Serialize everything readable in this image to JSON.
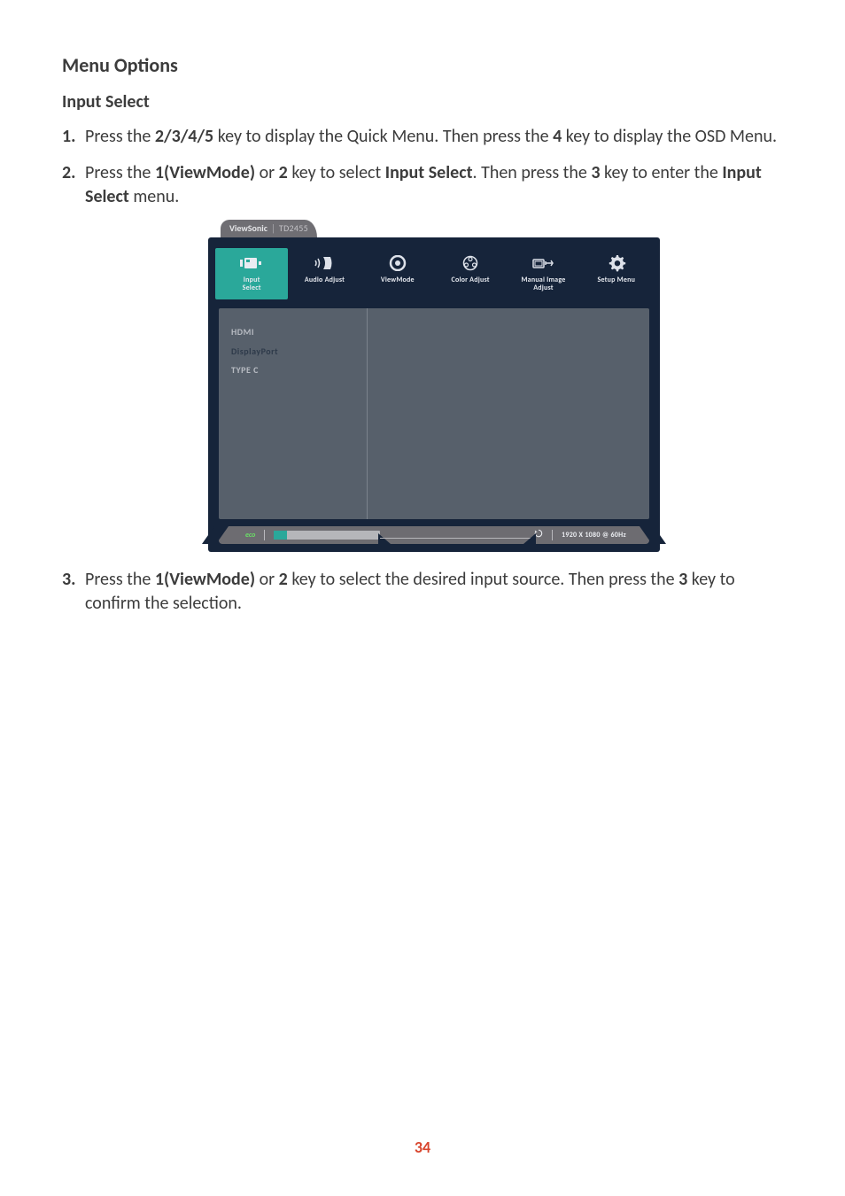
{
  "headings": {
    "menu_options": "Menu Options",
    "input_select": "Input Select"
  },
  "steps": {
    "s1": {
      "pre": "Press the ",
      "keys": "2/3/4/5",
      "mid": " key to display the Quick Menu. Then press the ",
      "key4": "4",
      "post": " key to display the OSD Menu."
    },
    "s2": {
      "pre": "Press the ",
      "k1": "1(ViewMode)",
      "or": " or ",
      "k2": "2",
      "mid": " key to select ",
      "sel": "Input Select",
      "then": ". Then press the ",
      "k3": "3",
      "enter": " key to enter the ",
      "sel2": "Input Select",
      "post": " menu."
    },
    "s3": {
      "pre": "Press the ",
      "k1": "1(ViewMode)",
      "or": " or ",
      "k2": "2",
      "mid": " key to select the desired input source. Then press the ",
      "k3": "3",
      "post": " key to confirm the selection."
    }
  },
  "osd": {
    "brand": "ViewSonic",
    "model": "TD2455",
    "tabs": {
      "input_select": "Input\nSelect",
      "audio_adjust": "Audio Adjust",
      "view_mode": "ViewMode",
      "color_adjust": "Color Adjust",
      "manual_image": "Manual Image\nAdjust",
      "setup_menu": "Setup Menu"
    },
    "input_options": {
      "hdmi": "HDMI",
      "displayport": "DisplayPort",
      "typec": "TYPE C"
    },
    "status": {
      "eco": "eco",
      "resolution": "1920 X 1080 @ 60Hz"
    }
  },
  "page_number": "34"
}
